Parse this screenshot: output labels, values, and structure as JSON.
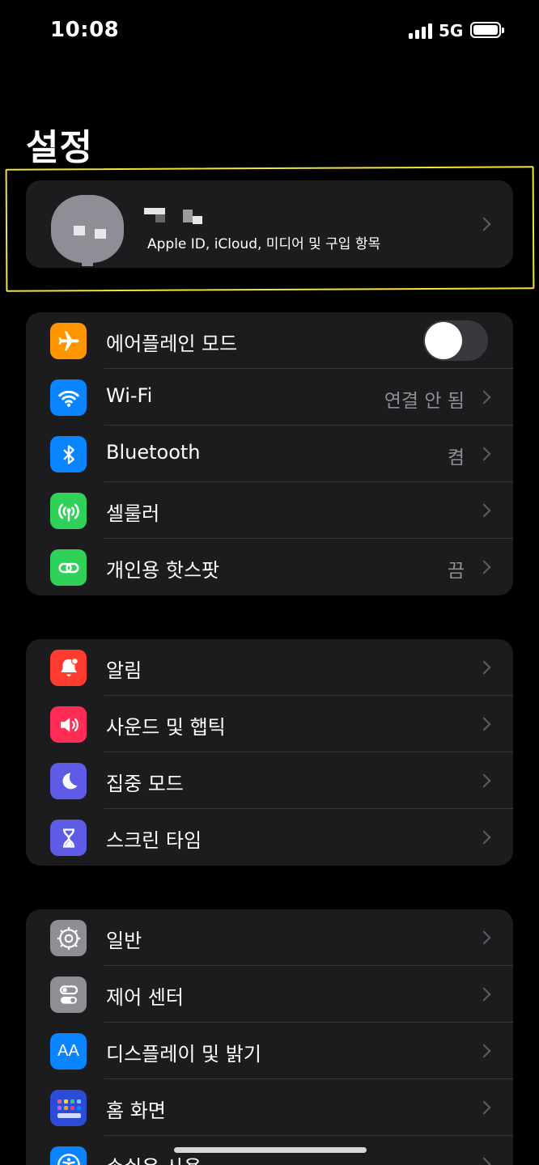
{
  "status_bar": {
    "time": "10:08",
    "network": "5G"
  },
  "page_title": "설정",
  "profile": {
    "subtitle": "Apple ID, iCloud, 미디어 및 구입 항목"
  },
  "group1": [
    {
      "label": "에어플레인 모드",
      "icon": "airplane-icon",
      "color": "#ff9500",
      "toggle": false
    },
    {
      "label": "Wi-Fi",
      "icon": "wifi-icon",
      "color": "#0a84ff",
      "value": "연결 안 됨"
    },
    {
      "label": "Bluetooth",
      "icon": "bluetooth-icon",
      "color": "#0a84ff",
      "value": "켬"
    },
    {
      "label": "셀룰러",
      "icon": "cellular-antenna-icon",
      "color": "#30d158"
    },
    {
      "label": "개인용 핫스팟",
      "icon": "hotspot-link-icon",
      "color": "#30d158",
      "value": "끔"
    }
  ],
  "group2": [
    {
      "label": "알림",
      "icon": "bell-icon",
      "color": "#ff3b30"
    },
    {
      "label": "사운드 및 햅틱",
      "icon": "speaker-icon",
      "color": "#ff2d55"
    },
    {
      "label": "집중 모드",
      "icon": "moon-icon",
      "color": "#5e5ce6"
    },
    {
      "label": "스크린 타임",
      "icon": "hourglass-icon",
      "color": "#5e5ce6"
    }
  ],
  "group3": [
    {
      "label": "일반",
      "icon": "gear-icon",
      "color": "#8e8e93"
    },
    {
      "label": "제어 센터",
      "icon": "switches-icon",
      "color": "#8e8e93"
    },
    {
      "label": "디스플레이 및 밝기",
      "icon": "text-size-icon",
      "color": "#0a84ff",
      "glyph": "AA"
    },
    {
      "label": "홈 화면",
      "icon": "app-grid-icon",
      "color": "#2c4cd6"
    },
    {
      "label": "손쉬운 사용",
      "icon": "accessibility-icon",
      "color": "#0a84ff"
    }
  ]
}
